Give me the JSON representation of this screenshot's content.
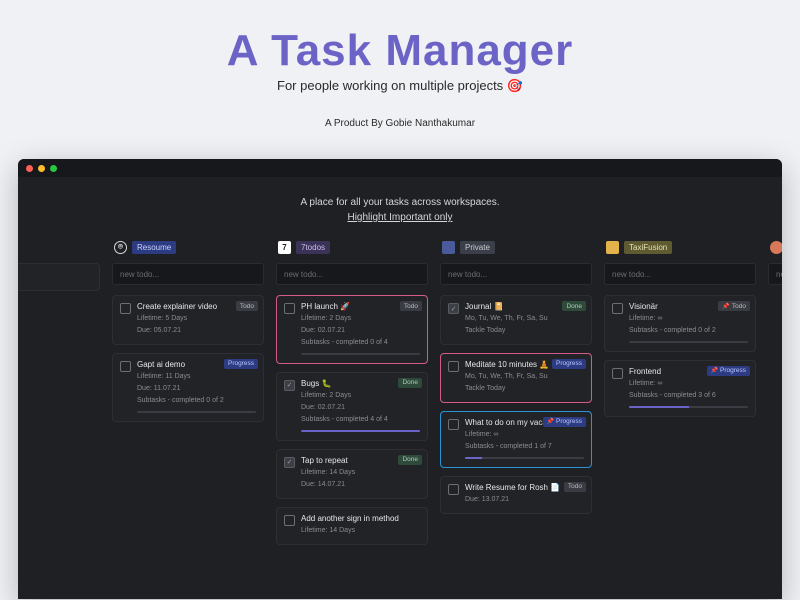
{
  "hero": {
    "title": "A Task Manager",
    "subtitle": "For people working on multiple projects 🎯",
    "byline": "A Product By Gobie Nanthakumar"
  },
  "app": {
    "tagline": "A place for all your tasks across workspaces.",
    "highlight_link": "Highlight Important only",
    "new_todo_placeholder": "new todo..."
  },
  "columns": [
    {
      "icon_class": "other",
      "icon_text": "",
      "label": "",
      "label_class": "",
      "show_head": false,
      "cards": [
        {
          "title": "",
          "meta_lines": [],
          "tag_label": "",
          "tag_class": "",
          "ring": "ring-orange-left",
          "sub_completed": 0,
          "sub_total": 0
        }
      ]
    },
    {
      "icon_class": "res",
      "icon_text": "⌾",
      "label": "Resoume",
      "label_class": "blue",
      "show_head": true,
      "cards": [
        {
          "title": "Create explainer video",
          "meta_lines": [
            "Lifetime: 5 Days",
            "Due: 05.07.21"
          ],
          "tag_label": "Todo",
          "tag_class": "todo",
          "pinned": false
        },
        {
          "title": "Gapt ai demo",
          "meta_lines": [
            "Lifetime: 11 Days",
            "Due: 11.07.21",
            "Subtasks - completed 0 of 2"
          ],
          "tag_label": "Progress",
          "tag_class": "progress",
          "sub_completed": 0,
          "sub_total": 2
        }
      ]
    },
    {
      "icon_class": "seven",
      "icon_text": "7",
      "label": "7todos",
      "label_class": "purple",
      "show_head": true,
      "cards": [
        {
          "title": "PH launch 🚀",
          "meta_lines": [
            "Lifetime: 2 Days",
            "Due: 02.07.21",
            "Subtasks - completed 0 of 4"
          ],
          "tag_label": "Todo",
          "tag_class": "todo",
          "ring": "ring-pink",
          "sub_completed": 0,
          "sub_total": 4
        },
        {
          "title": "Bugs 🐛",
          "meta_lines": [
            "Lifetime: 2 Days",
            "Due: 02.07.21",
            "Subtasks - completed 4 of 4"
          ],
          "tag_label": "Done",
          "tag_class": "done",
          "checked": true,
          "sub_completed": 4,
          "sub_total": 4
        },
        {
          "title": "Tap to repeat",
          "meta_lines": [
            "Lifetime: 14 Days",
            "Due: 14.07.21"
          ],
          "tag_label": "Done",
          "tag_class": "done",
          "checked": true
        },
        {
          "title": "Add another sign in method",
          "meta_lines": [
            "Lifetime: 14 Days"
          ],
          "tag_label": "",
          "tag_class": ""
        }
      ]
    },
    {
      "icon_class": "priv",
      "icon_text": "",
      "label": "Private",
      "label_class": "grey",
      "show_head": true,
      "cards": [
        {
          "title": "Journal 📔",
          "meta_lines": [
            "Mo, Tu, We, Th, Fr, Sa, Su",
            "Tackle Today"
          ],
          "tag_label": "Done",
          "tag_class": "done",
          "checked": true
        },
        {
          "title": "Meditate 10 minutes 🧘",
          "meta_lines": [
            "Mo, Tu, We, Th, Fr, Sa, Su",
            "Tackle Today"
          ],
          "tag_label": "Progress",
          "tag_class": "progress",
          "ring": "ring-pink"
        },
        {
          "title": "What to do on my vacation",
          "meta_lines": [
            "Lifetime: ∞",
            "Subtasks - completed 1 of 7"
          ],
          "tag_label": "Progress",
          "tag_class": "progress",
          "ring": "ring-blue",
          "pinned": true,
          "sub_completed": 1,
          "sub_total": 7
        },
        {
          "title": "Write Resume for Rosh 📄",
          "meta_lines": [
            "Due: 13.07.21"
          ],
          "tag_label": "Todo",
          "tag_class": "todo"
        }
      ]
    },
    {
      "icon_class": "taxi",
      "icon_text": "",
      "label": "TaxiFusion",
      "label_class": "olive",
      "show_head": true,
      "cards": [
        {
          "title": "Visionär",
          "meta_lines": [
            "Lifetime: ∞",
            "Subtasks - completed 0 of 2"
          ],
          "tag_label": "Todo",
          "tag_class": "todo",
          "pinned": true,
          "sub_completed": 0,
          "sub_total": 2
        },
        {
          "title": "Frontend",
          "meta_lines": [
            "Lifetime: ∞",
            "Subtasks - completed 3 of 6"
          ],
          "tag_label": "Progress",
          "tag_class": "progress",
          "pinned": true,
          "sub_completed": 3,
          "sub_total": 6
        }
      ]
    },
    {
      "icon_class": "other",
      "icon_text": "",
      "label": "",
      "label_class": "",
      "show_head": true,
      "cards": []
    }
  ]
}
